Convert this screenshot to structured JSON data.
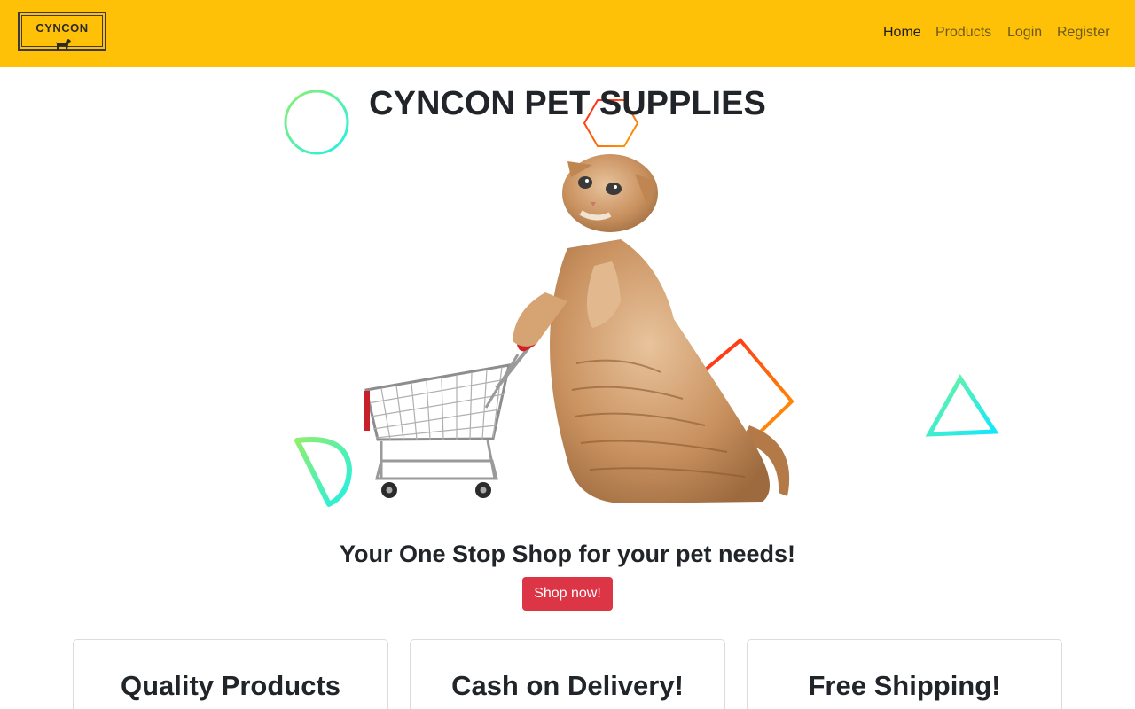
{
  "brand": {
    "logo_text": "CYNCON"
  },
  "nav": {
    "home": "Home",
    "products": "Products",
    "login": "Login",
    "register": "Register"
  },
  "hero": {
    "title": "CYNCON PET SUPPLIES",
    "tagline": "Your One Stop Shop for your pet needs!",
    "cta": "Shop now!"
  },
  "features": [
    {
      "title": "Quality Products"
    },
    {
      "title": "Cash on Delivery!"
    },
    {
      "title": "Free Shipping!"
    }
  ],
  "colors": {
    "navbar": "#ffc107",
    "cta": "#dc3545",
    "text": "#212529"
  },
  "icons": {
    "logo_mark": "dog-icon",
    "hero_image": "cat-with-shopping-cart"
  }
}
